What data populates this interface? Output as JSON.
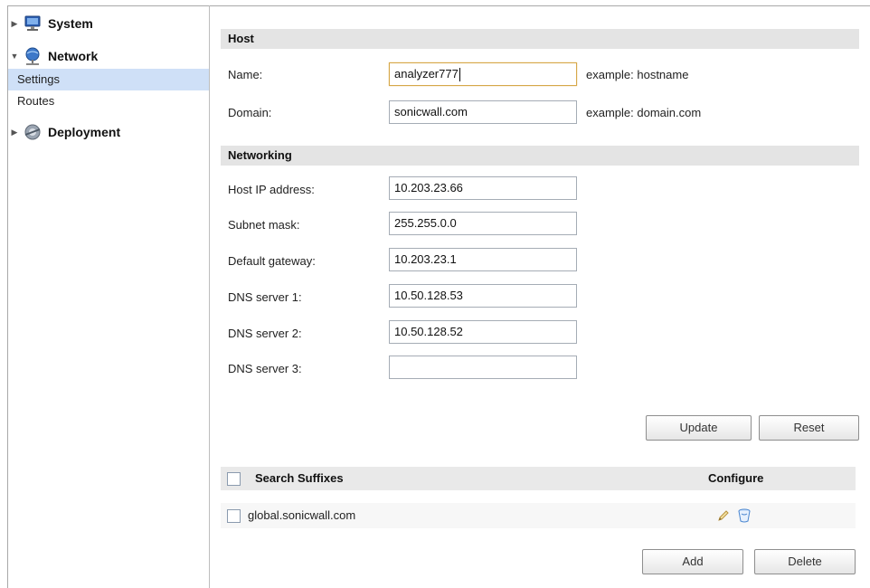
{
  "sidebar": {
    "system": {
      "label": "System",
      "arrow": "▶",
      "icon": "monitor-icon"
    },
    "network": {
      "label": "Network",
      "arrow": "▼",
      "icon": "network-globe-icon",
      "items": [
        {
          "label": "Settings",
          "selected": true
        },
        {
          "label": "Routes",
          "selected": false
        }
      ]
    },
    "deployment": {
      "label": "Deployment",
      "arrow": "▶",
      "icon": "deployment-icon"
    }
  },
  "host": {
    "header": "Host",
    "name_label": "Name:",
    "name_value": "analyzer777",
    "name_hint": "example: hostname",
    "domain_label": "Domain:",
    "domain_value": "sonicwall.com",
    "domain_hint": "example: domain.com"
  },
  "networking": {
    "header": "Networking",
    "fields": [
      {
        "label": "Host IP address:",
        "value": "10.203.23.66"
      },
      {
        "label": "Subnet mask:",
        "value": "255.255.0.0"
      },
      {
        "label": "Default gateway:",
        "value": "10.203.23.1"
      },
      {
        "label": "DNS server 1:",
        "value": "10.50.128.53"
      },
      {
        "label": "DNS server 2:",
        "value": "10.50.128.52"
      },
      {
        "label": "DNS server 3:",
        "value": ""
      }
    ]
  },
  "actions": {
    "update_label": "Update",
    "reset_label": "Reset"
  },
  "suffixes": {
    "header": "Search Suffixes",
    "configure_header": "Configure",
    "rows": [
      {
        "value": "global.sonicwall.com",
        "edit_icon": "pencil-icon",
        "delete_icon": "trash-icon"
      }
    ],
    "add_label": "Add",
    "delete_label": "Delete"
  },
  "colors": {
    "selected_bg": "#cfe0f7",
    "header_bg": "#e4e4e4",
    "focus_border": "#d6a84a"
  }
}
